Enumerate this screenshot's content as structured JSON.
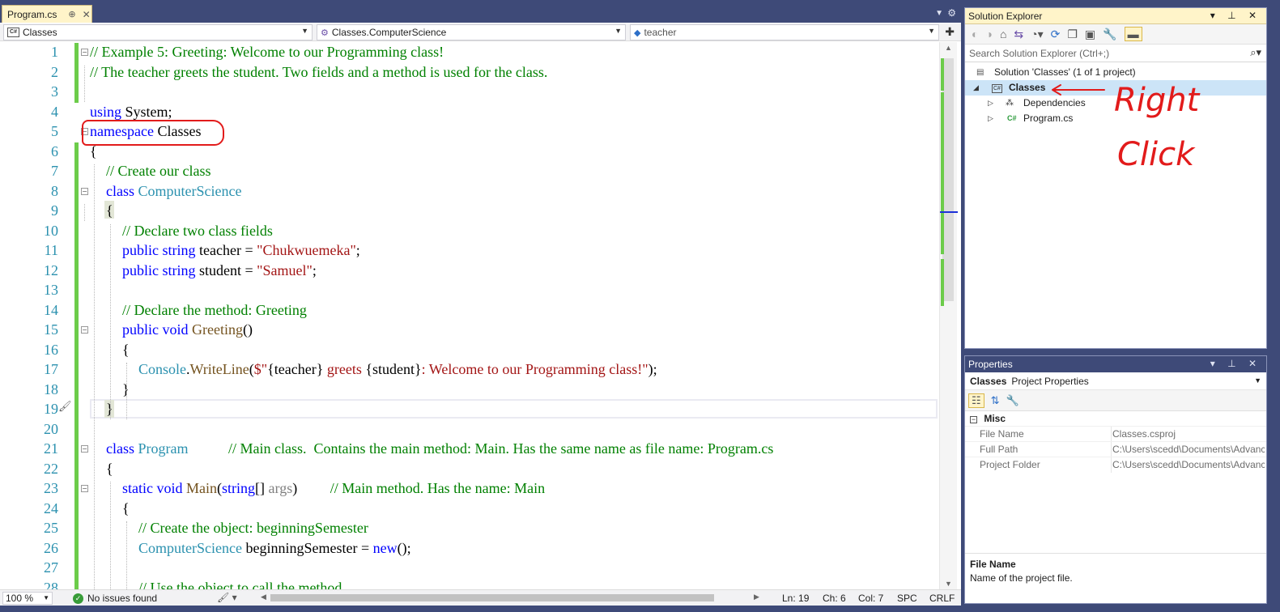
{
  "tab": {
    "title": "Program.cs",
    "pin": "⊕",
    "close": "✕"
  },
  "navbar": {
    "project": "Classes",
    "type": "Classes.ComputerScience",
    "member": "teacher"
  },
  "code_lines": [
    {
      "n": "1",
      "indent": 0,
      "parts": [
        [
          "cm",
          "// Example 5: Greeting: Welcome to our Programming class!"
        ]
      ]
    },
    {
      "n": "2",
      "indent": 0,
      "parts": [
        [
          "cm",
          "// The teacher greets the student. Two fields and a method is used for the class."
        ]
      ]
    },
    {
      "n": "3",
      "indent": 0,
      "parts": []
    },
    {
      "n": "4",
      "indent": 0,
      "parts": [
        [
          "kw",
          "using"
        ],
        [
          "",
          " System;"
        ]
      ]
    },
    {
      "n": "5",
      "indent": 0,
      "parts": [
        [
          "kw",
          "namespace"
        ],
        [
          "",
          " Classes"
        ]
      ]
    },
    {
      "n": "6",
      "indent": 0,
      "parts": [
        [
          "",
          "{"
        ]
      ]
    },
    {
      "n": "7",
      "indent": 1,
      "parts": [
        [
          "cm",
          "// Create our class"
        ]
      ]
    },
    {
      "n": "8",
      "indent": 1,
      "parts": [
        [
          "kw",
          "class"
        ],
        [
          "",
          " "
        ],
        [
          "ty",
          "ComputerScience"
        ]
      ]
    },
    {
      "n": "9",
      "indent": 1,
      "parts": [
        [
          "",
          "{"
        ]
      ]
    },
    {
      "n": "10",
      "indent": 2,
      "parts": [
        [
          "cm",
          "// Declare two class fields"
        ]
      ]
    },
    {
      "n": "11",
      "indent": 2,
      "parts": [
        [
          "kw",
          "public"
        ],
        [
          "",
          " "
        ],
        [
          "kw",
          "string"
        ],
        [
          "",
          " teacher = "
        ],
        [
          "st",
          "\"Chukwuemeka\""
        ],
        [
          "",
          ";"
        ]
      ]
    },
    {
      "n": "12",
      "indent": 2,
      "parts": [
        [
          "kw",
          "public"
        ],
        [
          "",
          " "
        ],
        [
          "kw",
          "string"
        ],
        [
          "",
          " student = "
        ],
        [
          "st",
          "\"Samuel\""
        ],
        [
          "",
          ";"
        ]
      ]
    },
    {
      "n": "13",
      "indent": 0,
      "parts": []
    },
    {
      "n": "14",
      "indent": 2,
      "parts": [
        [
          "cm",
          "// Declare the method: Greeting"
        ]
      ]
    },
    {
      "n": "15",
      "indent": 2,
      "parts": [
        [
          "kw",
          "public"
        ],
        [
          "",
          " "
        ],
        [
          "kw",
          "void"
        ],
        [
          "",
          " "
        ],
        [
          "mt",
          "Greeting"
        ],
        [
          "",
          "()"
        ]
      ]
    },
    {
      "n": "16",
      "indent": 2,
      "parts": [
        [
          "",
          "{"
        ]
      ]
    },
    {
      "n": "17",
      "indent": 3,
      "parts": [
        [
          "ty",
          "Console"
        ],
        [
          "",
          "."
        ],
        [
          "mt",
          "WriteLine"
        ],
        [
          "",
          "("
        ],
        [
          "st",
          "$\""
        ],
        [
          "",
          "{teacher}"
        ],
        [
          "st",
          " greets "
        ],
        [
          "",
          "{student}"
        ],
        [
          "st",
          ": Welcome to our Programming class!\""
        ],
        [
          "",
          ");"
        ]
      ]
    },
    {
      "n": "18",
      "indent": 2,
      "parts": [
        [
          "",
          "}"
        ]
      ]
    },
    {
      "n": "19",
      "indent": 1,
      "parts": [
        [
          "",
          "}"
        ]
      ]
    },
    {
      "n": "20",
      "indent": 0,
      "parts": []
    },
    {
      "n": "21",
      "indent": 1,
      "parts": [
        [
          "kw",
          "class"
        ],
        [
          "",
          " "
        ],
        [
          "ty",
          "Program"
        ],
        [
          "",
          "           "
        ],
        [
          "cm",
          "// Main class.  Contains the main method: Main. Has the same name as file name: Program.cs"
        ]
      ]
    },
    {
      "n": "22",
      "indent": 1,
      "parts": [
        [
          "",
          "{"
        ]
      ]
    },
    {
      "n": "23",
      "indent": 2,
      "parts": [
        [
          "kw",
          "static"
        ],
        [
          "",
          " "
        ],
        [
          "kw",
          "void"
        ],
        [
          "",
          " "
        ],
        [
          "mt",
          "Main"
        ],
        [
          "",
          "("
        ],
        [
          "kw",
          "string"
        ],
        [
          "",
          "[] "
        ],
        [
          "pr",
          "args"
        ],
        [
          "",
          ")         "
        ],
        [
          "cm",
          "// Main method. Has the name: Main"
        ]
      ]
    },
    {
      "n": "24",
      "indent": 2,
      "parts": [
        [
          "",
          "{"
        ]
      ]
    },
    {
      "n": "25",
      "indent": 3,
      "parts": [
        [
          "cm",
          "// Create the object: beginningSemester"
        ]
      ]
    },
    {
      "n": "26",
      "indent": 3,
      "parts": [
        [
          "ty",
          "ComputerScience"
        ],
        [
          "",
          " beginningSemester = "
        ],
        [
          "kw",
          "new"
        ],
        [
          "",
          "();"
        ]
      ]
    },
    {
      "n": "27",
      "indent": 0,
      "parts": []
    },
    {
      "n": "28",
      "indent": 3,
      "parts": [
        [
          "cm",
          "// Use the object to call the method"
        ]
      ]
    }
  ],
  "status": {
    "zoom": "100 %",
    "issues": "No issues found",
    "ln": "Ln: 19",
    "ch": "Ch: 6",
    "col": "Col: 7",
    "spc": "SPC",
    "crlf": "CRLF"
  },
  "solution_explorer": {
    "title": "Solution Explorer",
    "search_placeholder": "Search Solution Explorer (Ctrl+;)",
    "solution": "Solution 'Classes' (1 of 1 project)",
    "project": "Classes",
    "items": [
      "Dependencies",
      "Program.cs"
    ]
  },
  "annotation": {
    "line1": "Right",
    "line2": "Click"
  },
  "properties": {
    "title": "Properties",
    "object_name": "Classes",
    "object_type": "Project Properties",
    "category": "Misc",
    "rows": [
      {
        "name": "File Name",
        "value": "Classes.csproj"
      },
      {
        "name": "Full Path",
        "value": "C:\\Users\\scedd\\Documents\\Advanced"
      },
      {
        "name": "Project Folder",
        "value": "C:\\Users\\scedd\\Documents\\Advanced"
      }
    ],
    "desc_title": "File Name",
    "desc_text": "Name of the project file."
  }
}
